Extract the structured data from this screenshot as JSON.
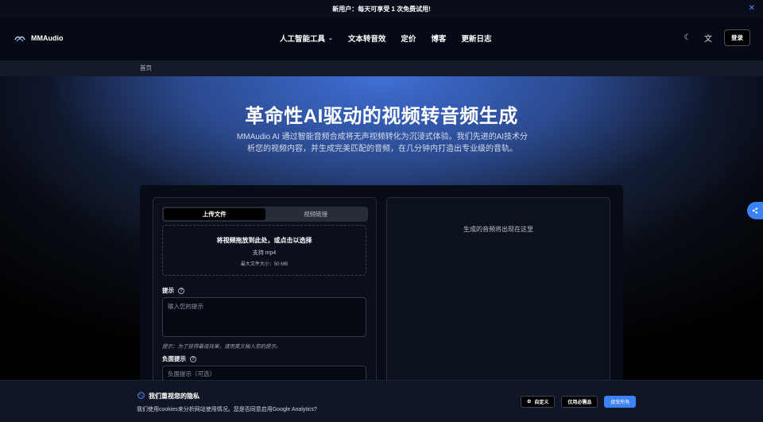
{
  "announcement": {
    "text": "新用户：每天可享受 1 次免费试用!",
    "close": "✕"
  },
  "nav": {
    "brand": "MMAudio",
    "menu": [
      {
        "label": "人工智能工具",
        "dropdown": true
      },
      {
        "label": "文本转音效"
      },
      {
        "label": "定价"
      },
      {
        "label": "博客"
      },
      {
        "label": "更新日志"
      }
    ],
    "theme_icon": "☾",
    "lang_icon": "文",
    "login": "登录"
  },
  "breadcrumb": {
    "home": "首页"
  },
  "hero": {
    "title": "革命性AI驱动的视频转音频生成",
    "subtitle": "MMAudio AI 通过智能音频合成将无声视频转化为沉浸式体验。我们先进的AI技术分析您的视频内容，并生成完美匹配的音频，在几分钟内打造出专业级的音轨。"
  },
  "form": {
    "tabs": [
      "上传文件",
      "视频链接"
    ],
    "active_tab": 0,
    "drop": {
      "title": "将视频拖放到此处，或点击以选择",
      "support": "支持 mp4",
      "max_size": "最大文件大小：50 MB"
    },
    "prompt_label": "提示",
    "prompt_placeholder": "输入您的提示",
    "prompt_hint": "提示：为了获得最佳效果，请用英文输入您的提示。",
    "negative_label": "负面提示",
    "negative_placeholder": "负面提示（可选）"
  },
  "output": {
    "placeholder": "生成的音频将出现在这里"
  },
  "cookie": {
    "title": "我们重视您的隐私",
    "description": "我们使用cookies来分析网站使用情况。您是否同意启用Google Analytics?",
    "customize": "自定义",
    "necessary": "仅用必需品",
    "accept": "接受所有"
  },
  "colors": {
    "accent": "#3b82f6",
    "nav_bg": "#050914",
    "panel_bg": "#080c16"
  }
}
